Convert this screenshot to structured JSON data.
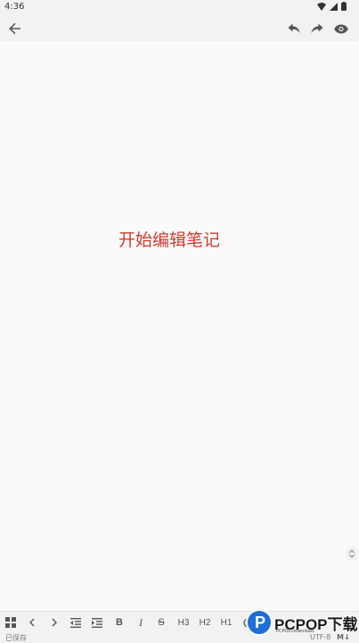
{
  "status_bar": {
    "time": "4:36"
  },
  "editor": {
    "placeholder": "开始编辑笔记"
  },
  "toolbar": {
    "bold_label": "B",
    "italic_label": "I",
    "strike_label": "S",
    "h3_label": "H3",
    "h2_label": "H2",
    "h1_label": "H1"
  },
  "footer": {
    "saved_label": "已保存",
    "encoding": "UTF-8",
    "format_badge": "M↓"
  },
  "watermark": {
    "logo_letter": "P",
    "text": "PCPOP下载",
    "subtext": "PCPOP.Download"
  },
  "colors": {
    "placeholder": "#d23a2d",
    "background": "#fafafa",
    "bar": "#f2f2f2",
    "watermark_blue": "#1f6fd6"
  }
}
